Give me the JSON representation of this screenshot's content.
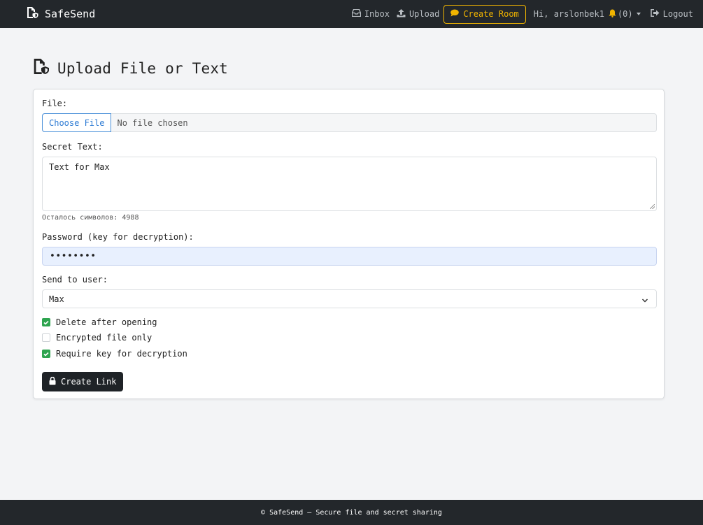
{
  "navbar": {
    "brand": "SafeSend",
    "inbox_label": "Inbox",
    "upload_label": "Upload",
    "create_room_label": "Create Room",
    "greeting": "Hi, arslonbek1",
    "notifications": "(0)",
    "logout_label": "Logout",
    "accent_color": "#f0b400"
  },
  "page": {
    "title": "Upload File or Text"
  },
  "form": {
    "file_label": "File:",
    "file_button": "Choose File",
    "file_status": "No file chosen",
    "secret_label": "Secret Text:",
    "secret_value": "Text for Max",
    "chars_left": "Осталось символов: 4988",
    "password_label": "Password (key for decryption):",
    "password_value": "••••••••",
    "recipient_label": "Send to user:",
    "recipient_value": "Max",
    "checkboxes": [
      {
        "label": "Delete after opening",
        "checked": true
      },
      {
        "label": "Encrypted file only",
        "checked": false
      },
      {
        "label": "Require key for decryption",
        "checked": true
      }
    ],
    "submit_label": "Create Link",
    "check_color": "#2ea44f"
  },
  "footer": {
    "text": "© SafeSend — Secure file and secret sharing"
  }
}
